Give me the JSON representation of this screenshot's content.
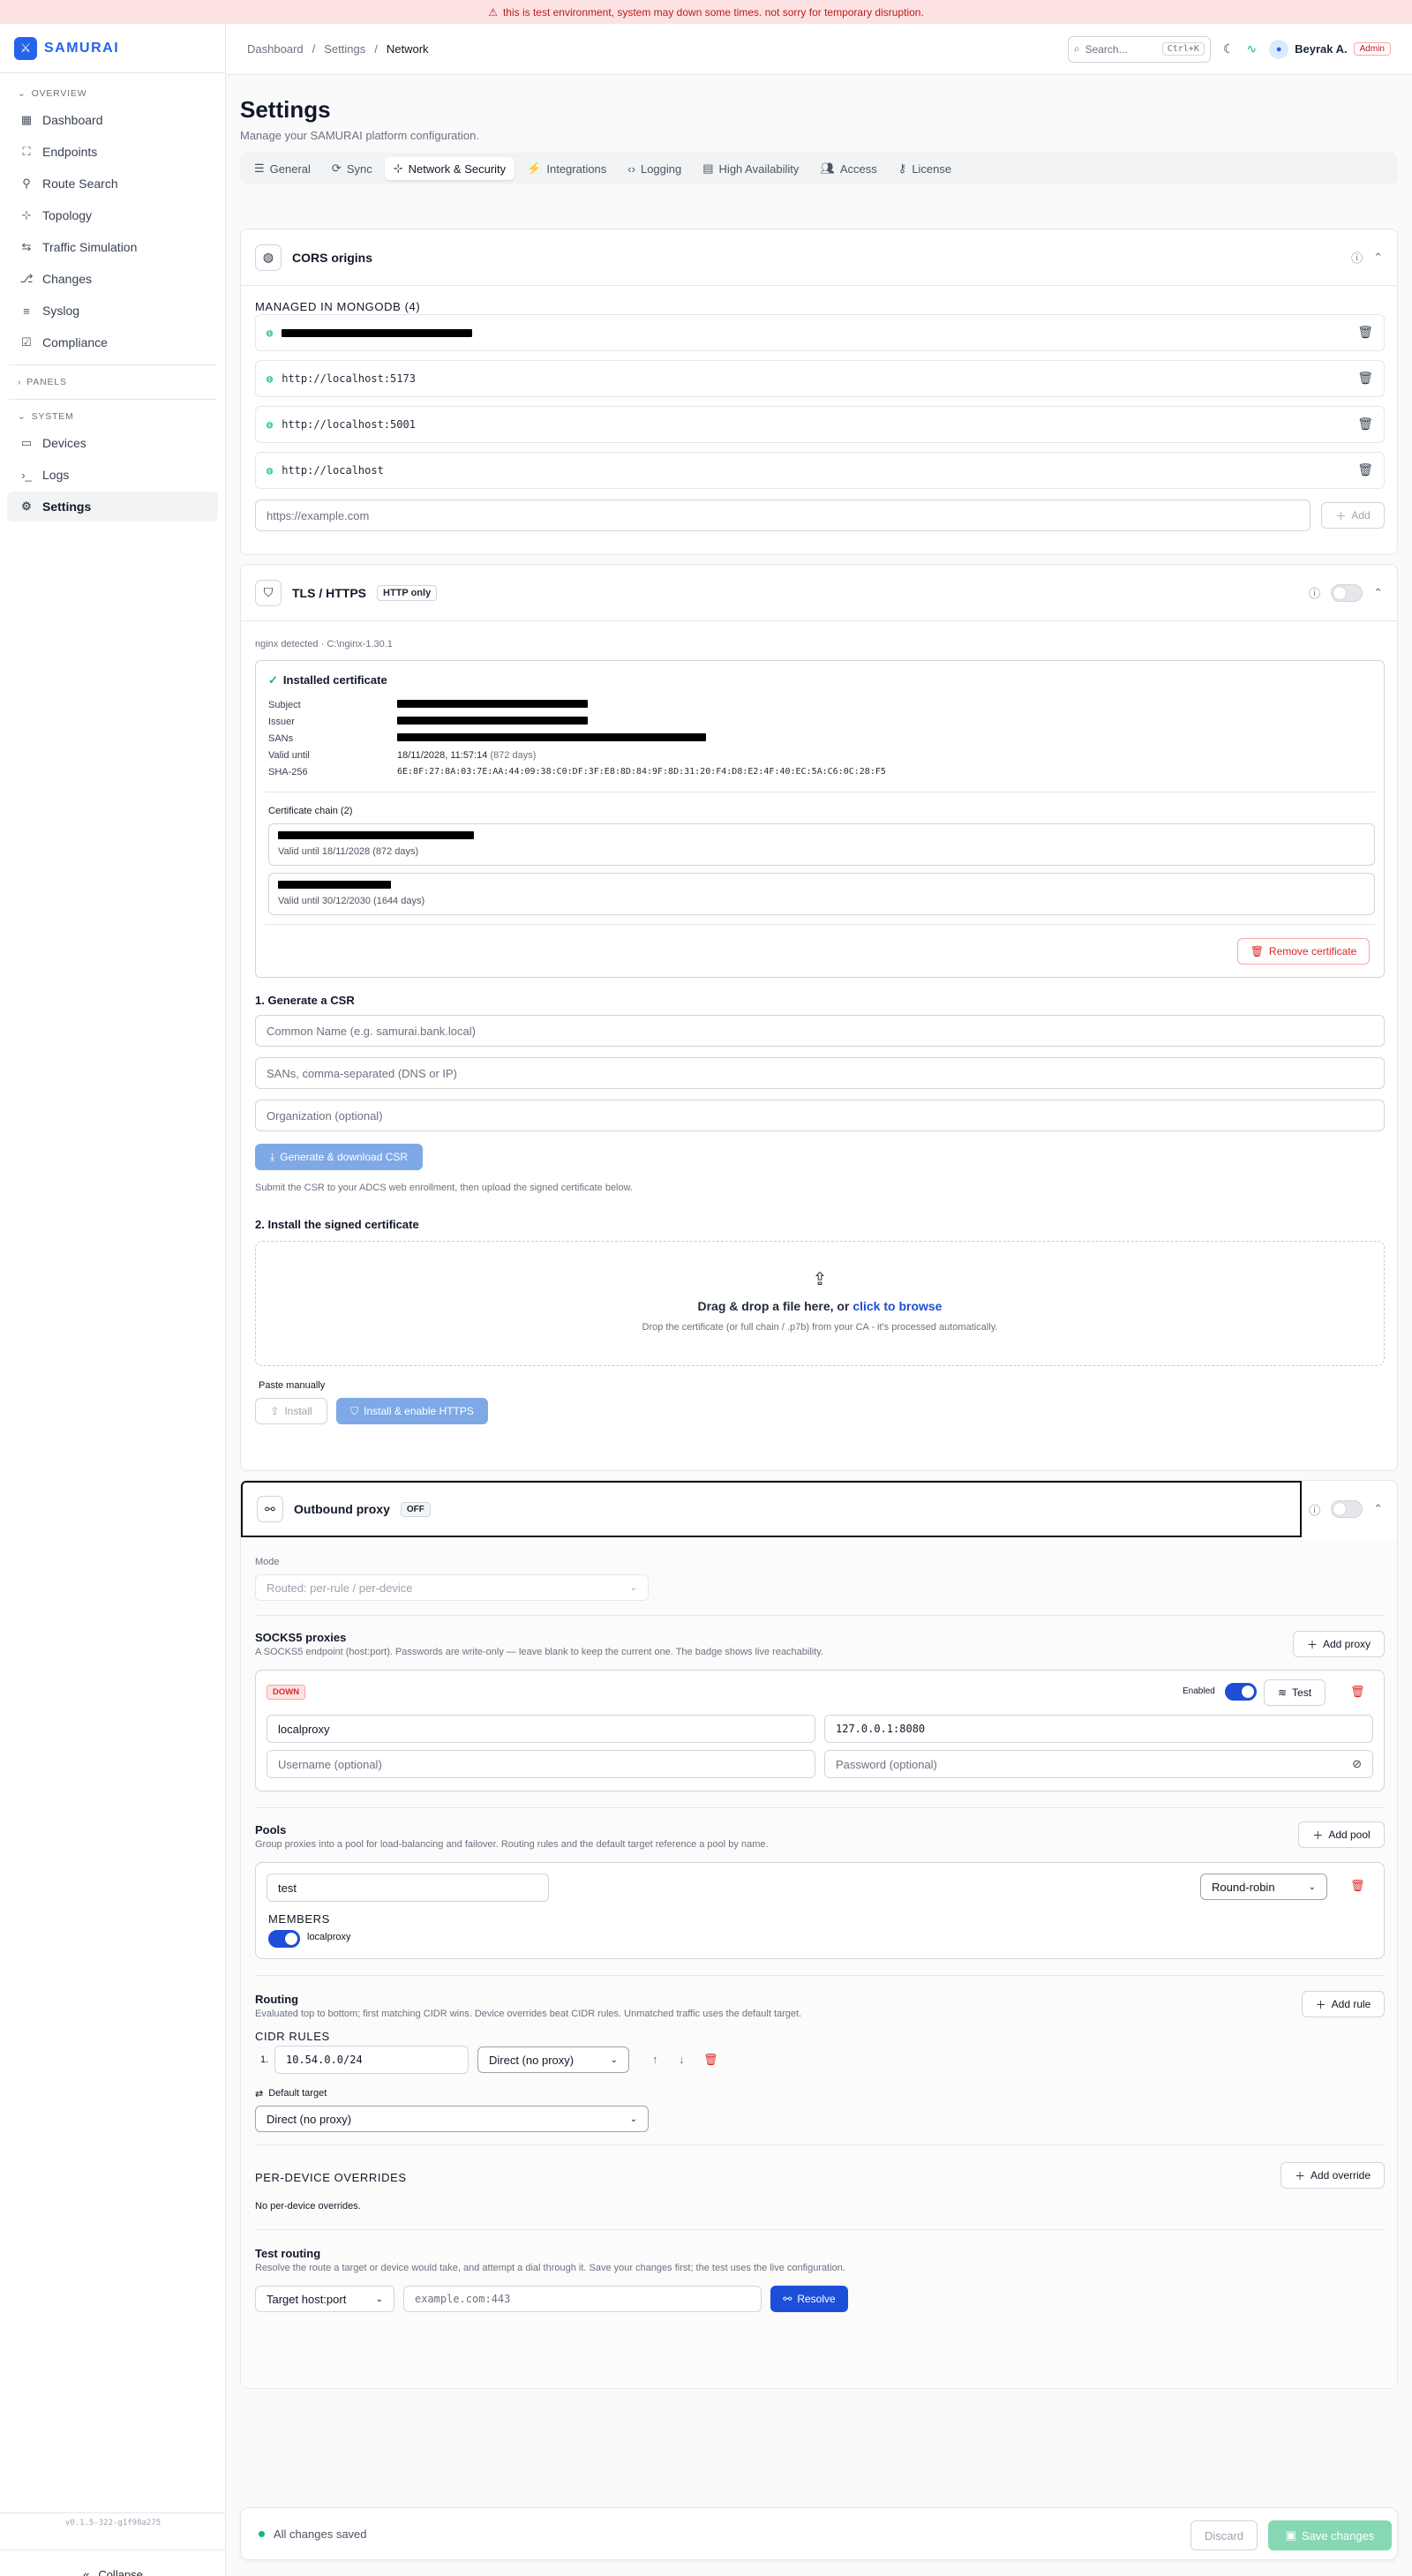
{
  "banner": {
    "text": "this is test environment, system may down some times. not sorry for temporary disruption."
  },
  "brand": {
    "name": "SAMURAI"
  },
  "sidebar": {
    "overview_label": "OVERVIEW",
    "overview_items": [
      {
        "label": "Dashboard",
        "icon": "grid-icon"
      },
      {
        "label": "Endpoints",
        "icon": "scan-icon"
      },
      {
        "label": "Route Search",
        "icon": "route-icon"
      },
      {
        "label": "Topology",
        "icon": "topology-icon"
      },
      {
        "label": "Traffic Simulation",
        "icon": "traffic-icon"
      },
      {
        "label": "Changes",
        "icon": "changes-icon"
      },
      {
        "label": "Syslog",
        "icon": "syslog-icon"
      },
      {
        "label": "Compliance",
        "icon": "compliance-icon"
      }
    ],
    "panels_label": "PANELS",
    "system_label": "SYSTEM",
    "system_items": [
      {
        "label": "Devices",
        "icon": "monitor-icon"
      },
      {
        "label": "Logs",
        "icon": "terminal-icon"
      },
      {
        "label": "Settings",
        "icon": "gear-icon",
        "active": true
      }
    ],
    "version": "v0.1.5-322-g1f98a275",
    "collapse_label": "Collapse"
  },
  "topbar": {
    "breadcrumb": [
      "Dashboard",
      "Settings",
      "Network"
    ],
    "search_placeholder": "Search...",
    "search_shortcut": "Ctrl+K",
    "user_name": "Beyrak A.",
    "user_role": "Admin"
  },
  "page": {
    "title": "Settings",
    "subtitle": "Manage your SAMURAI platform configuration.",
    "tabs": [
      "General",
      "Sync",
      "Network & Security",
      "Integrations",
      "Logging",
      "High Availability",
      "Access",
      "License"
    ],
    "active_tab": "Network & Security"
  },
  "cors": {
    "title": "CORS origins",
    "managed_label": "MANAGED IN MONGODB (4)",
    "origins": [
      "",
      "http://localhost:5173",
      "http://localhost:5001",
      "http://localhost"
    ],
    "input_placeholder": "https://example.com",
    "add_label": "Add"
  },
  "tls": {
    "title": "TLS / HTTPS",
    "badge": "HTTP only",
    "nginx": "nginx detected · C:\\nginx-1.30.1",
    "installed_title": "Installed certificate",
    "fields": {
      "subject_label": "Subject",
      "issuer_label": "Issuer",
      "sans_label": "SANs",
      "valid_until_label": "Valid until",
      "valid_until": "18/11/2028, 11:57:14",
      "valid_until_days": "(872 days)",
      "sha_label": "SHA-256",
      "sha": "6E:8F:27:8A:03:7E:AA:44:09:38:C0:DF:3F:E8:8D:84:9F:8D:31:20:F4:D8:E2:4F:40:EC:5A:C6:0C:28:F5"
    },
    "chain_title": "Certificate chain (2)",
    "chain": [
      {
        "valid": "Valid until 18/11/2028 (872 days)"
      },
      {
        "valid": "Valid until 30/12/2030 (1644 days)"
      }
    ],
    "remove_label": "Remove certificate",
    "csr_title": "1. Generate a CSR",
    "cn_placeholder": "Common Name (e.g. samurai.bank.local)",
    "sans_placeholder": "SANs, comma-separated (DNS or IP)",
    "org_placeholder": "Organization (optional)",
    "generate_label": "Generate & download CSR",
    "csr_hint": "Submit the CSR to your ADCS web enrollment, then upload the signed certificate below.",
    "install_title": "2. Install the signed certificate",
    "drop_main": "Drag & drop a file here, or",
    "drop_link": "click to browse",
    "drop_hint": "Drop the certificate (or full chain / .p7b) from your CA - it's processed automatically.",
    "paste_label": "Paste manually",
    "install_label": "Install",
    "install_enable_label": "Install & enable HTTPS"
  },
  "proxy": {
    "title": "Outbound proxy",
    "badge": "OFF",
    "mode_label": "Mode",
    "mode_value": "Routed: per-rule / per-device",
    "socks_title": "SOCKS5 proxies",
    "socks_desc": "A SOCKS5 endpoint (host:port). Passwords are write-only — leave blank to keep the current one. The badge shows live reachability.",
    "add_proxy_label": "Add proxy",
    "proxy_status": "DOWN",
    "enabled_label": "Enabled",
    "test_label": "Test",
    "proxy_name": "localproxy",
    "proxy_addr": "127.0.0.1:8080",
    "username_placeholder": "Username (optional)",
    "password_placeholder": "Password (optional)",
    "pools_title": "Pools",
    "pools_desc": "Group proxies into a pool for load-balancing and failover. Routing rules and the default target reference a pool by name.",
    "add_pool_label": "Add pool",
    "pool_name": "test",
    "pool_strategy": "Round-robin",
    "members_label": "MEMBERS",
    "member_name": "localproxy",
    "routing_title": "Routing",
    "routing_desc": "Evaluated top to bottom; first matching CIDR wins. Device overrides beat CIDR rules. Unmatched traffic uses the default target.",
    "add_rule_label": "Add rule",
    "cidr_label": "CIDR RULES",
    "rule_index": "1.",
    "rule_cidr": "10.54.0.0/24",
    "rule_target": "Direct (no proxy)",
    "default_target_label": "Default target",
    "default_target_value": "Direct (no proxy)",
    "overrides_label": "PER-DEVICE OVERRIDES",
    "add_override_label": "Add override",
    "no_overrides": "No per-device overrides.",
    "test_title": "Test routing",
    "test_desc": "Resolve the route a target or device would take, and attempt a dial through it. Save your changes first; the test uses the live configuration.",
    "test_type": "Target host:port",
    "test_placeholder": "example.com:443",
    "resolve_label": "Resolve"
  },
  "savebar": {
    "status": "All changes saved",
    "discard_label": "Discard",
    "save_label": "Save changes"
  },
  "colors": {
    "accent": "#1d4ed8",
    "brand": "#2563eb",
    "danger": "#dc2626",
    "success": "#10b981"
  }
}
